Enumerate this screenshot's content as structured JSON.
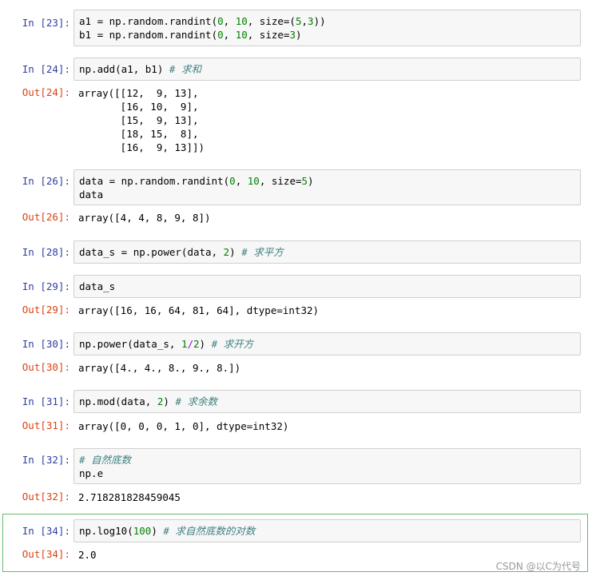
{
  "cells": [
    {
      "in_label": "In  [23]:",
      "lines": [
        "a1 = np.random.randint(0, 10, size=(5,3))",
        "b1 = np.random.randint(0, 10, size=3)"
      ]
    },
    {
      "in_label": "In  [24]:",
      "lines": [
        "np.add(a1, b1) # 求和"
      ],
      "out_label": "Out[24]:",
      "out_lines": [
        "array([[12,  9, 13],",
        "       [16, 10,  9],",
        "       [15,  9, 13],",
        "       [18, 15,  8],",
        "       [16,  9, 13]])"
      ]
    },
    {
      "in_label": "In  [26]:",
      "lines": [
        "data = np.random.randint(0, 10, size=5)",
        "data"
      ],
      "out_label": "Out[26]:",
      "out_lines": [
        "array([4, 4, 8, 9, 8])"
      ]
    },
    {
      "in_label": "In  [28]:",
      "lines": [
        "data_s = np.power(data, 2) # 求平方"
      ]
    },
    {
      "in_label": "In  [29]:",
      "lines": [
        "data_s"
      ],
      "out_label": "Out[29]:",
      "out_lines": [
        "array([16, 16, 64, 81, 64], dtype=int32)"
      ]
    },
    {
      "in_label": "In  [30]:",
      "lines": [
        "np.power(data_s, 1/2) # 求开方"
      ],
      "out_label": "Out[30]:",
      "out_lines": [
        "array([4., 4., 8., 9., 8.])"
      ]
    },
    {
      "in_label": "In  [31]:",
      "lines": [
        "np.mod(data, 2) # 求余数"
      ],
      "out_label": "Out[31]:",
      "out_lines": [
        "array([0, 0, 0, 1, 0], dtype=int32)"
      ]
    },
    {
      "in_label": "In  [32]:",
      "lines": [
        "# 自然底数",
        "np.e"
      ],
      "out_label": "Out[32]:",
      "out_lines": [
        "2.718281828459045"
      ]
    },
    {
      "in_label": "In  [34]:",
      "lines": [
        "np.log10(100) # 求自然底数的对数"
      ],
      "out_label": "Out[34]:",
      "out_lines": [
        "2.0"
      ]
    }
  ],
  "watermark": "CSDN @以C为代号",
  "colors": {
    "in_prompt": "#303f9f",
    "out_prompt": "#d84315",
    "number": "#008000",
    "comment": "#408080",
    "selected_border": "#66bb6a"
  }
}
